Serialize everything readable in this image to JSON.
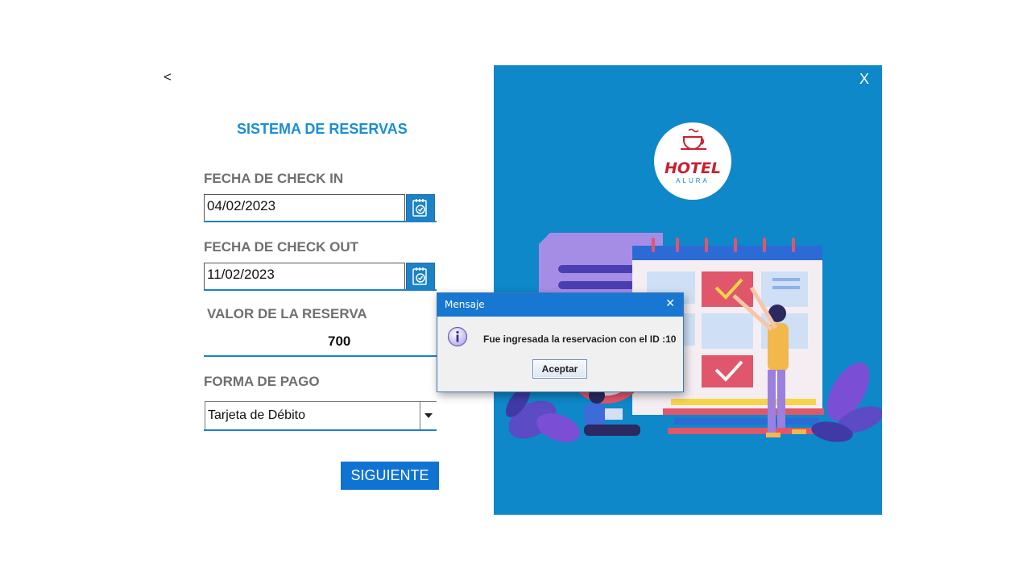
{
  "form": {
    "back_label": "<",
    "title": "SISTEMA DE RESERVAS",
    "checkin_label": "FECHA DE CHECK IN",
    "checkin_value": "04/02/2023",
    "checkout_label": "FECHA DE CHECK OUT",
    "checkout_value": "11/02/2023",
    "valor_label": "VALOR DE LA RESERVA",
    "valor_value": "700",
    "pago_label": "FORMA DE PAGO",
    "pago_value": "Tarjeta de Débito",
    "next_button": "SIGUIENTE"
  },
  "side_panel": {
    "close_label": "X",
    "logo_text": "HOTEL",
    "logo_subtext": "ALURA",
    "background": "#0e88c8"
  },
  "dialog": {
    "title": "Mensaje",
    "close_label": "✕",
    "message": "Fue ingresada la reservacion con el ID :10",
    "ok_button": "Aceptar",
    "icon": "info-icon"
  },
  "colors": {
    "accent": "#1b82c9",
    "title": "#1a8fd2",
    "button": "#0f73d1"
  }
}
